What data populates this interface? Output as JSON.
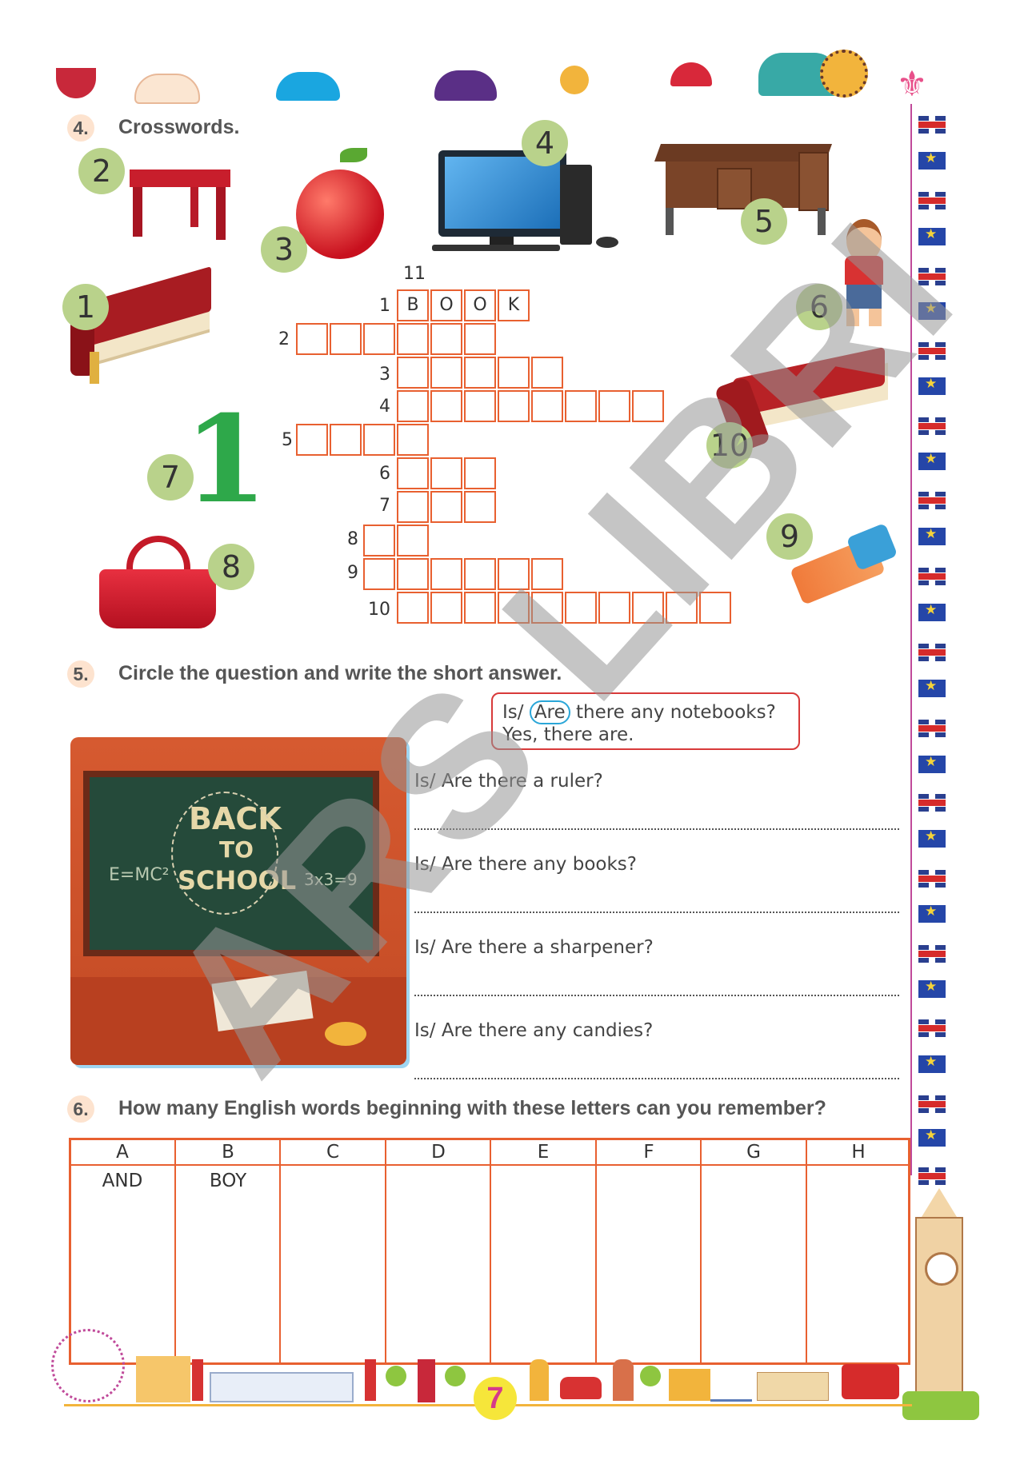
{
  "page_number": "7",
  "watermark": "ARS LIBRI",
  "exercise4": {
    "number": "4.",
    "title": "Crosswords.",
    "picture_badges": [
      "1",
      "2",
      "3",
      "4",
      "5",
      "6",
      "7",
      "8",
      "9",
      "10"
    ],
    "seven_glyph": "1",
    "top_number": "11",
    "row_numbers": [
      "1",
      "2",
      "3",
      "4",
      "5",
      "6",
      "7",
      "8",
      "9",
      "10"
    ],
    "answer_letters": [
      "B",
      "O",
      "O",
      "K"
    ]
  },
  "exercise5": {
    "number": "5.",
    "title": "Circle the question and write the short answer.",
    "example": {
      "is": "Is/",
      "are": "Are",
      "rest": "there any notebooks?",
      "answer": "Yes, there are."
    },
    "picture_text": {
      "line1": "BACK",
      "line2": "TO",
      "line3": "SCHOOL",
      "formula1": "E=MC²",
      "formula2": "3x3=9"
    },
    "questions": [
      "Is/ Are there a ruler?",
      "Is/ Are there any books?",
      "Is/ Are there a sharpener?",
      "Is/ Are there any candies?"
    ]
  },
  "exercise6": {
    "number": "6.",
    "title": "How many English words beginning with these letters can you remember?",
    "columns": [
      "A",
      "B",
      "C",
      "D",
      "E",
      "F",
      "G",
      "H"
    ],
    "answers": [
      "AND",
      "BOY",
      "",
      "",
      "",
      "",
      "",
      ""
    ]
  }
}
